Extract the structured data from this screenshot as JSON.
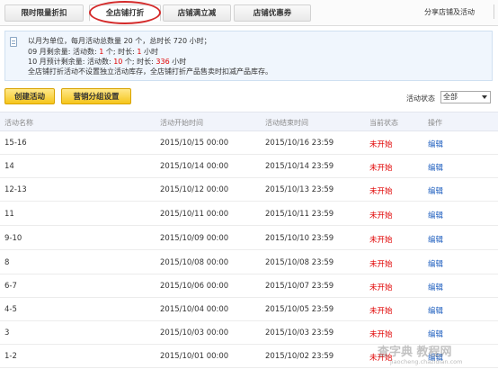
{
  "tabs": [
    {
      "label": "限时限量折扣"
    },
    {
      "label": "全店铺打折"
    },
    {
      "label": "店铺满立减"
    },
    {
      "label": "店铺优惠券"
    }
  ],
  "share_label": "分享店铺及活动",
  "info": {
    "line1": "以月为单位，每月活动总数量 20 个，总时长 720 小时；",
    "line2_prefix": "09 月剩余量: 活动数: ",
    "line2_count": "1",
    "line2_mid": " 个; 时长: ",
    "line2_hours": "1",
    "line2_suffix": " 小时",
    "line3_prefix": "10 月预计剩余量: 活动数: ",
    "line3_count": "10",
    "line3_mid": " 个; 时长: ",
    "line3_hours": "336",
    "line3_suffix": " 小时",
    "line4": "全店铺打折活动不设置独立活动库存，全店铺打折产品售卖时扣减产品库存。"
  },
  "buttons": {
    "create": "创建活动",
    "group": "营销分组设置"
  },
  "status_filter": {
    "label": "活动状态",
    "value": "全部"
  },
  "table": {
    "headers": {
      "name": "活动名称",
      "start": "活动开始时间",
      "end": "活动结束时间",
      "status": "当前状态",
      "action": "操作"
    },
    "rows": [
      {
        "name": "15-16",
        "start": "2015/10/15 00:00",
        "end": "2015/10/16 23:59",
        "status": "未开始",
        "action": "编辑"
      },
      {
        "name": "14",
        "start": "2015/10/14 00:00",
        "end": "2015/10/14 23:59",
        "status": "未开始",
        "action": "编辑"
      },
      {
        "name": "12-13",
        "start": "2015/10/12 00:00",
        "end": "2015/10/13 23:59",
        "status": "未开始",
        "action": "编辑"
      },
      {
        "name": "11",
        "start": "2015/10/11 00:00",
        "end": "2015/10/11 23:59",
        "status": "未开始",
        "action": "编辑"
      },
      {
        "name": "9-10",
        "start": "2015/10/09 00:00",
        "end": "2015/10/10 23:59",
        "status": "未开始",
        "action": "编辑"
      },
      {
        "name": "8",
        "start": "2015/10/08 00:00",
        "end": "2015/10/08 23:59",
        "status": "未开始",
        "action": "编辑"
      },
      {
        "name": "6-7",
        "start": "2015/10/06 00:00",
        "end": "2015/10/07 23:59",
        "status": "未开始",
        "action": "编辑"
      },
      {
        "name": "4-5",
        "start": "2015/10/04 00:00",
        "end": "2015/10/05 23:59",
        "status": "未开始",
        "action": "编辑"
      },
      {
        "name": "3",
        "start": "2015/10/03 00:00",
        "end": "2015/10/03 23:59",
        "status": "未开始",
        "action": "编辑"
      },
      {
        "name": "1-2",
        "start": "2015/10/01 00:00",
        "end": "2015/10/02 23:59",
        "status": "未开始",
        "action": "编辑"
      }
    ]
  },
  "watermark": {
    "main": "查字典 教程网",
    "sub": "jiaocheng.chazidian.com"
  },
  "colors": {
    "accent_red": "#e00000",
    "link_blue": "#1f5fbf",
    "button_yellow": "#f5c51b",
    "info_bg": "#f0f6fd"
  }
}
